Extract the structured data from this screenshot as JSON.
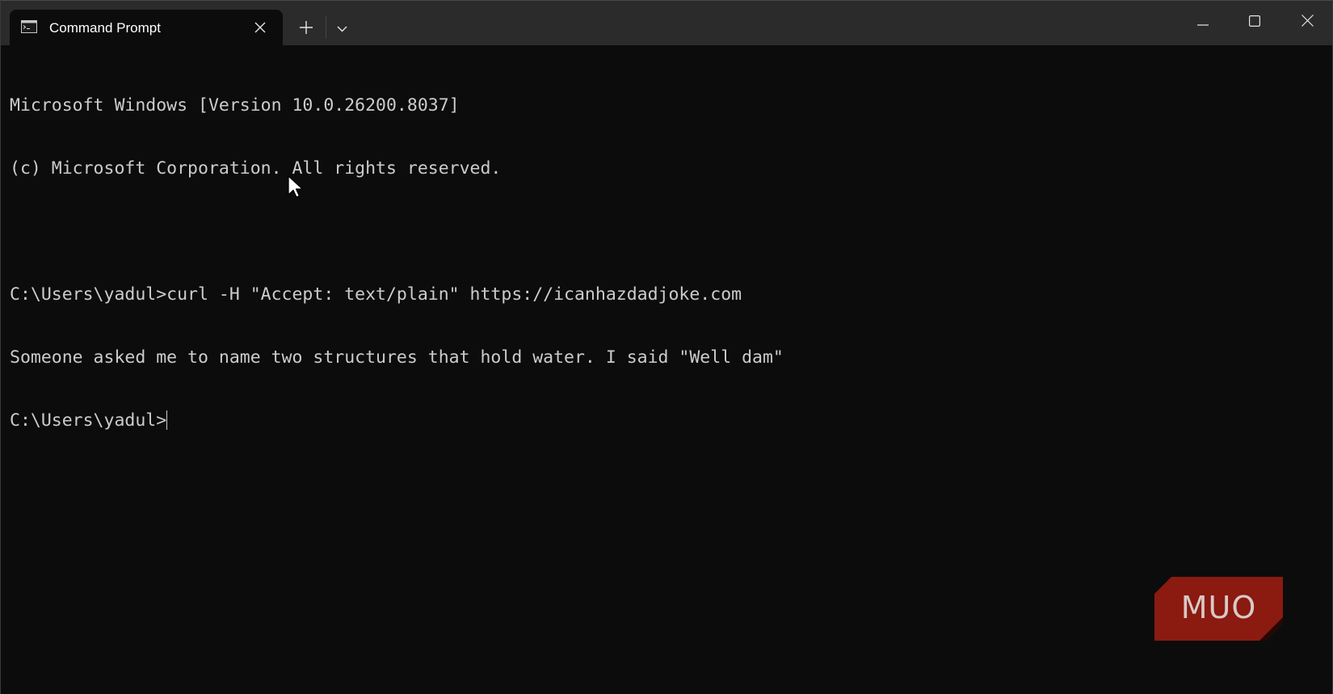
{
  "window": {
    "tab_title": "Command Prompt",
    "icons": {
      "tab": "terminal-icon",
      "tab_close": "close-icon",
      "new_tab": "plus-icon",
      "dropdown": "chevron-down-icon",
      "minimize": "minimize-icon",
      "maximize": "maximize-icon",
      "close": "close-icon"
    }
  },
  "terminal": {
    "lines": [
      "Microsoft Windows [Version 10.0.26200.8037]",
      "(c) Microsoft Corporation. All rights reserved.",
      "",
      "C:\\Users\\yadul>curl -H \"Accept: text/plain\" https://icanhazdadjoke.com",
      "Someone asked me to name two structures that hold water. I said \"Well dam\""
    ],
    "prompt": "C:\\Users\\yadul>"
  },
  "watermark": {
    "text": "MUO",
    "color": "#8b1a10"
  },
  "colors": {
    "titlebar": "#2b2b2b",
    "background": "#0c0c0c",
    "text": "#cccccc"
  }
}
